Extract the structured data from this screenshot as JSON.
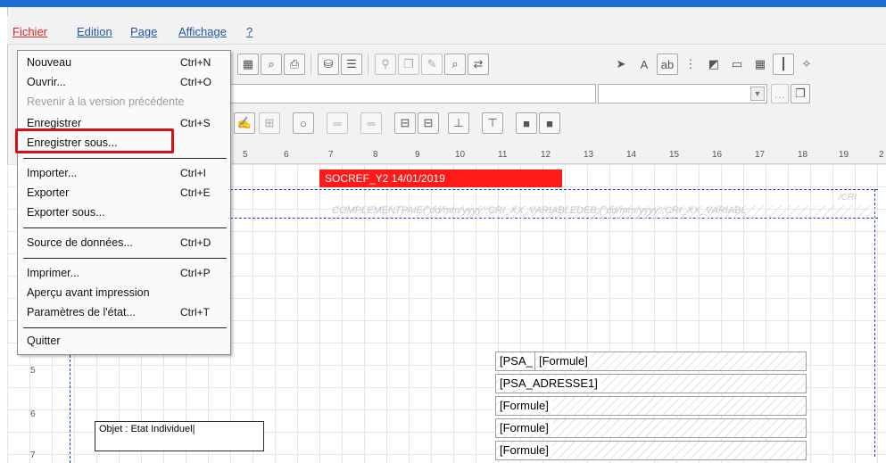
{
  "menubar": {
    "items": [
      "Fichier",
      "Edition",
      "Page",
      "Affichage",
      "?"
    ]
  },
  "file_menu": {
    "items": [
      {
        "label": "Nouveau",
        "shortcut": "Ctrl+N",
        "enabled": true
      },
      {
        "label": "Ouvrir...",
        "shortcut": "Ctrl+O",
        "enabled": true
      },
      {
        "label": "Revenir à la version précédente",
        "shortcut": "",
        "enabled": false
      },
      {
        "label": "Enregistrer",
        "shortcut": "Ctrl+S",
        "enabled": true
      },
      {
        "label": "Enregistrer sous...",
        "shortcut": "",
        "enabled": true,
        "highlighted": true
      },
      {
        "label": "Importer...",
        "shortcut": "Ctrl+I",
        "enabled": true
      },
      {
        "label": "Exporter",
        "shortcut": "Ctrl+E",
        "enabled": true
      },
      {
        "label": "Exporter sous...",
        "shortcut": "",
        "enabled": true
      },
      {
        "label": "Source de données...",
        "shortcut": "Ctrl+D",
        "enabled": true
      },
      {
        "label": "Imprimer...",
        "shortcut": "Ctrl+P",
        "enabled": true
      },
      {
        "label": "Aperçu avant impression",
        "shortcut": "",
        "enabled": true
      },
      {
        "label": "Paramètres de l'état...",
        "shortcut": "Ctrl+T",
        "enabled": true
      },
      {
        "label": "Quitter",
        "shortcut": "",
        "enabled": true
      }
    ]
  },
  "ruler": {
    "ticks": [
      "5",
      "6",
      "7",
      "8",
      "9",
      "10",
      "11",
      "12",
      "13",
      "14",
      "15",
      "16",
      "17",
      "18",
      "19",
      "2"
    ]
  },
  "left_ruler": {
    "ticks": [
      "5",
      "6",
      "7"
    ]
  },
  "canvas": {
    "red_field": "SOCREF_Y2 14/01/2019",
    "ghost_text": "COMPLEMENTPAIE(\"dd/mm/yyyy\";CRI_XX_VARIABLEDEB;(\"dd/mm/yyyy\";CRI_XX_VARIABL",
    "ghost_small": "/CRI",
    "fields": [
      "[PSA_",
      "[Formule]",
      "[PSA_ADRESSE1]",
      "[Formule]",
      "[Formule]",
      "[Formule]"
    ],
    "textbox": "Objet : Etat Individuel"
  },
  "colors": {
    "title_bar": "#1f6fd2",
    "highlight": "#d41010",
    "red_field": "#ff1a1a",
    "dashed_line": "#1a3bc4"
  }
}
